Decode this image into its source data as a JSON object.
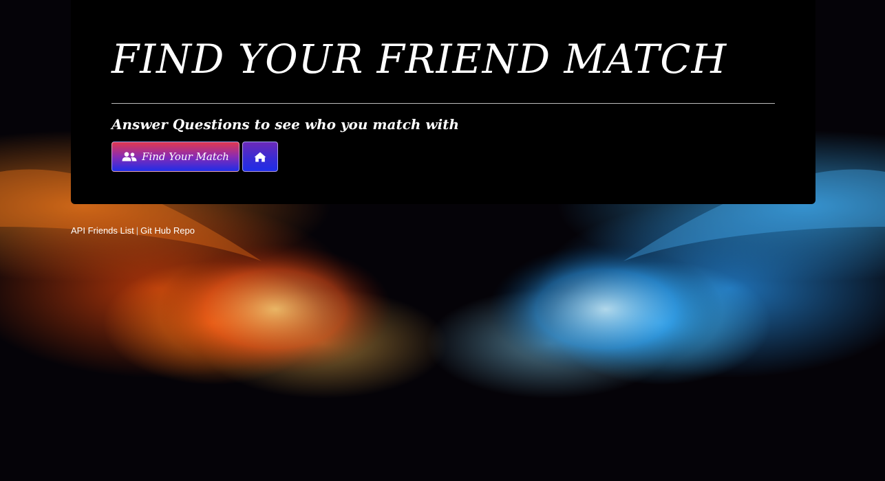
{
  "header": {
    "title": "FIND YOUR FRIEND MATCH",
    "subtitle": "Answer Questions to see who you match with"
  },
  "buttons": {
    "find_match": {
      "label": "Find Your Match",
      "icon": "users-icon"
    },
    "home": {
      "icon": "home-icon"
    }
  },
  "footer_links": {
    "api_friends": "API Friends List",
    "separator": "|",
    "github": "Git Hub Repo"
  },
  "colors": {
    "panel": "#000000",
    "button_gradient_top": "#e0394f",
    "button_gradient_bottom": "#1e2de8",
    "text": "#ffffff"
  }
}
